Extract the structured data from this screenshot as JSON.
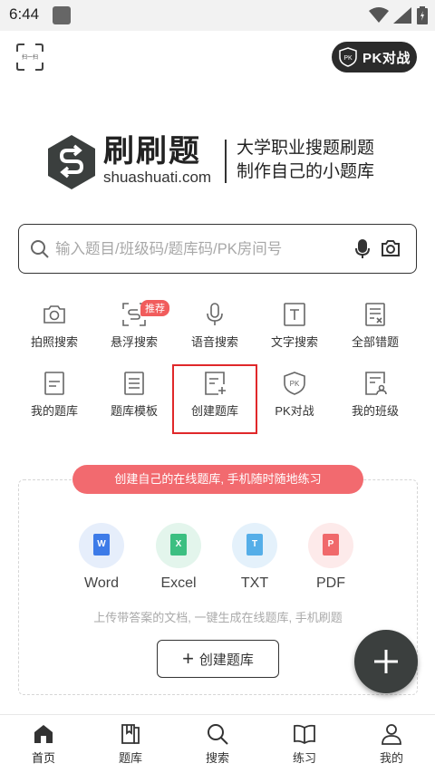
{
  "status_bar": {
    "time": "6:44"
  },
  "header": {
    "scan_label": "扫一扫",
    "pk_button": "PK对战",
    "pk_badge": "PK"
  },
  "logo": {
    "name": "刷刷题",
    "url": "shuashuati.com",
    "slogan_line1": "大学职业搜题刷题",
    "slogan_line2": "制作自己的小题库"
  },
  "search": {
    "placeholder": "输入题目/班级码/题库码/PK房间号",
    "value": ""
  },
  "grid": [
    {
      "label": "拍照搜索",
      "icon": "camera-search-icon"
    },
    {
      "label": "悬浮搜索",
      "icon": "floating-search-icon",
      "badge": "推荐"
    },
    {
      "label": "语音搜索",
      "icon": "microphone-icon"
    },
    {
      "label": "文字搜索",
      "icon": "text-search-icon"
    },
    {
      "label": "全部错题",
      "icon": "wrong-questions-icon"
    },
    {
      "label": "我的题库",
      "icon": "my-question-bank-icon"
    },
    {
      "label": "题库模板",
      "icon": "template-icon"
    },
    {
      "label": "创建题库",
      "icon": "create-bank-icon",
      "highlighted": true
    },
    {
      "label": "PK对战",
      "icon": "pk-shield-icon"
    },
    {
      "label": "我的班级",
      "icon": "my-class-icon"
    }
  ],
  "create_card": {
    "promo": "创建自己的在线题库, 手机随时随地练习",
    "file_types": [
      {
        "label": "Word",
        "letter": "W",
        "bg": "#e6eefb",
        "fg": "#3d7be8"
      },
      {
        "label": "Excel",
        "letter": "X",
        "bg": "#e3f5ec",
        "fg": "#3cbf81"
      },
      {
        "label": "TXT",
        "letter": "T",
        "bg": "#e4f1fb",
        "fg": "#55aee8"
      },
      {
        "label": "PDF",
        "letter": "P",
        "bg": "#fdeaea",
        "fg": "#f0696b"
      }
    ],
    "description": "上传带答案的文档, 一键生成在线题库, 手机刷题",
    "button": "创建题库"
  },
  "tabbar": [
    {
      "label": "首页",
      "icon": "home-icon",
      "active": true
    },
    {
      "label": "题库",
      "icon": "question-bank-icon"
    },
    {
      "label": "搜索",
      "icon": "search-icon"
    },
    {
      "label": "练习",
      "icon": "practice-book-icon"
    },
    {
      "label": "我的",
      "icon": "profile-icon"
    }
  ],
  "colors": {
    "accent_red": "#f26a6f",
    "highlight_border": "#e0282a",
    "fab_bg": "#3b3f3e",
    "dark": "#2b2b2b"
  }
}
